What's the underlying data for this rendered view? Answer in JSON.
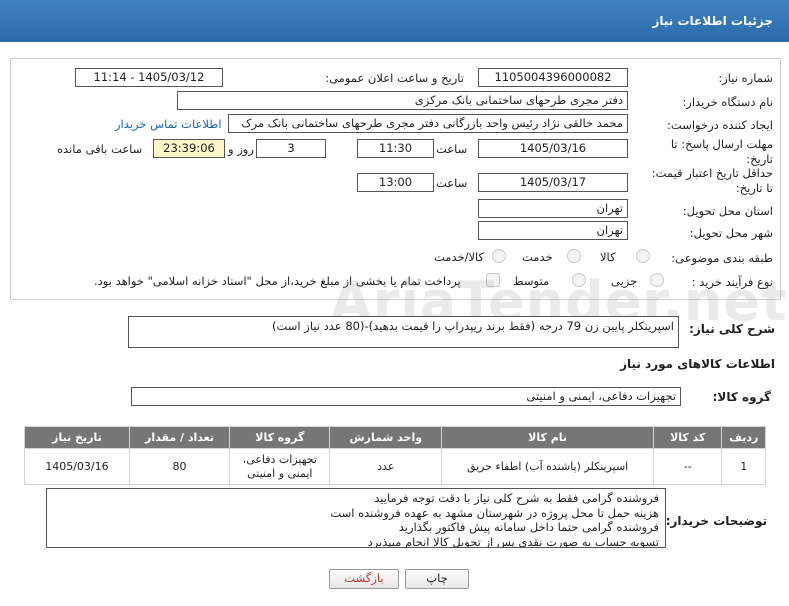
{
  "header": {
    "title": "جزئیات اطلاعات نیاز"
  },
  "form": {
    "need_number_label": "شماره نیاز:",
    "need_number": "1105004396000082",
    "announce_label": "تاریخ و ساعت اعلان عمومی:",
    "announce_value": "1405/03/12 - 11:14",
    "buyer_label": "نام دستگاه خریدار:",
    "buyer_value": "دفتر مجری طرحهای ساختمانی بانک مرکزی",
    "creator_label": "ایجاد کننده درخواست:",
    "creator_value": "محمد خالقی نژاد رئیس واحد بازرگانی دفتر مجری طرحهای ساختمانی بانک مرک",
    "contact_link": "اطلاعات تماس خریدار",
    "reply_label_1": "مهلت ارسال پاسخ: تا",
    "reply_label_2": "تاریخ:",
    "reply_date": "1405/03/16",
    "time_label": "ساعت",
    "reply_time": "11:30",
    "days_value": "3",
    "days_label": "روز و",
    "remaining_value": "23:39:06",
    "remaining_label": "ساعت باقی مانده",
    "validity_label_1": "حداقل تاریخ اعتبار قیمت:",
    "validity_label_2": "تا تاریخ:",
    "validity_date": "1405/03/17",
    "validity_time_label": "ساعت",
    "validity_time": "13:00",
    "province_label": "استان محل تحویل:",
    "province_value": "تهران",
    "city_label": "شهر محل تحویل:",
    "city_value": "تهران",
    "category_label": "طبقه بندی موضوعی:",
    "category_options": [
      "کالا",
      "خدمت",
      "کالا/خدمت"
    ],
    "process_label": "نوع فرآیند خرید :",
    "process_options": [
      "جزیی",
      "متوسط"
    ],
    "payment_note": "پرداخت تمام یا بخشی از مبلغ خرید،از محل \"اسناد خزانه اسلامی\" خواهد بود."
  },
  "description": {
    "label": "شرح کلی نیاز:",
    "value": "اسپرینکلر پایین زن 79 درجه (فقط برند ریپدراپ را قیمت بدهید)-(80 عدد نیاز است)"
  },
  "goods": {
    "section_title": "اطلاعات کالاهای مورد نیاز",
    "group_label": "گروه کالا:",
    "group_value": "تجهیزات دفاعی، ایمنی و امنیتی",
    "columns": [
      "ردیف",
      "کد کالا",
      "نام کالا",
      "واحد شمارش",
      "گروه کالا",
      "تعداد / مقدار",
      "تاریخ نیاز"
    ],
    "rows": [
      {
        "row": "1",
        "code": "--",
        "name": "اسپرینکلر (پاشنده آب) اطفاء حریق",
        "unit": "عدد",
        "group_line1": "تجهیزات دفاعی،",
        "group_line2": "ایمنی و امنیتی",
        "qty": "80",
        "date": "1405/03/16"
      }
    ]
  },
  "buyer_notes": {
    "label": "توضیحات خریدار:",
    "lines": [
      "فروشنده گرامی فقط به شرح کلی نیاز  با دقت توجه فرمایید",
      "هزینه حمل تا محل پروژه در شهرستان مشهد به عهده فروشنده است",
      "فروشنده گرامی حتما داخل سامانه پیش فاکتور بگذارید",
      "تسویه حساب به صورت نقدی پس از تحویل کالا  انجام میپذیرد"
    ]
  },
  "buttons": {
    "print": "چاپ",
    "back": "بازگشت"
  },
  "watermark": "AriaTender.net",
  "colors": {
    "header": "#2f72b6",
    "table_header": "#767676",
    "back_text": "#c0392b",
    "link": "#1565c0"
  }
}
